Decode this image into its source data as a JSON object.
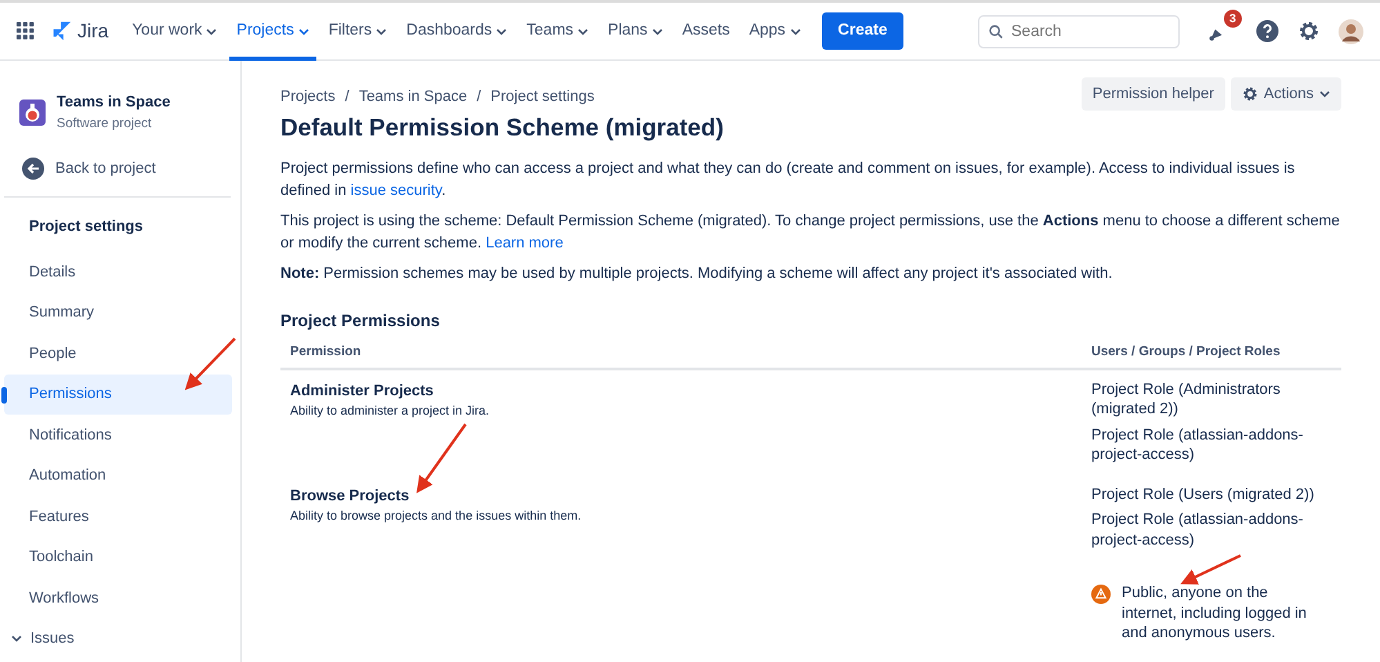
{
  "topbar": {
    "product": "Jira",
    "nav": [
      {
        "label": "Your work",
        "selected": false,
        "dropdown": true
      },
      {
        "label": "Projects",
        "selected": true,
        "dropdown": true
      },
      {
        "label": "Filters",
        "selected": false,
        "dropdown": true
      },
      {
        "label": "Dashboards",
        "selected": false,
        "dropdown": true
      },
      {
        "label": "Teams",
        "selected": false,
        "dropdown": true
      },
      {
        "label": "Plans",
        "selected": false,
        "dropdown": true
      },
      {
        "label": "Assets",
        "selected": false,
        "dropdown": false
      },
      {
        "label": "Apps",
        "selected": false,
        "dropdown": true
      }
    ],
    "create": "Create",
    "search": {
      "placeholder": "Search"
    },
    "notifications": "3"
  },
  "sidebar": {
    "project": {
      "name": "Teams in Space",
      "type": "Software project"
    },
    "back": "Back to project",
    "heading": "Project settings",
    "items": [
      {
        "label": "Details",
        "selected": false,
        "kind": "link"
      },
      {
        "label": "Summary",
        "selected": false,
        "kind": "link"
      },
      {
        "label": "People",
        "selected": false,
        "kind": "link"
      },
      {
        "label": "Permissions",
        "selected": true,
        "kind": "link"
      },
      {
        "label": "Notifications",
        "selected": false,
        "kind": "link"
      },
      {
        "label": "Automation",
        "selected": false,
        "kind": "link"
      },
      {
        "label": "Features",
        "selected": false,
        "kind": "link"
      },
      {
        "label": "Toolchain",
        "selected": false,
        "kind": "link"
      },
      {
        "label": "Workflows",
        "selected": false,
        "kind": "link"
      },
      {
        "label": "Issues",
        "selected": false,
        "kind": "group",
        "expanded": true
      }
    ]
  },
  "breadcrumbs": [
    {
      "label": "Projects"
    },
    {
      "separator": "/",
      "label": "Teams in Space"
    },
    {
      "separator": "/",
      "label": "Project settings"
    }
  ],
  "actions": {
    "helper": "Permission helper",
    "menu": "Actions"
  },
  "title": "Default Permission Scheme (migrated)",
  "paragraphs": [
    {
      "text": "Project permissions define who can access a project and what they can do (create and comment on issues, for example). Access to individual issues is defined in",
      "link": "issue security",
      "tail": "."
    },
    {
      "text": "This project is using the scheme: Default Permission Scheme (migrated). To change project permissions, use the **Actions** menu to choose a different scheme or modify the current scheme.",
      "link": "Learn more"
    },
    {
      "text": "**Note:** Permission schemes may be used by multiple projects. Modifying a scheme will affect any project it's associated with."
    }
  ],
  "section_title": "Project Permissions",
  "table": {
    "columns": [
      "Permission",
      "Users / Groups / Project Roles"
    ],
    "rows": [
      {
        "name": "Administer Projects",
        "description": "Ability to administer a project in Jira.",
        "grants": [
          {
            "kind": "role",
            "text": "Project Role (Administrators (migrated 2))"
          },
          {
            "kind": "role",
            "text": "Project Role (atlassian-addons-project-access)"
          }
        ]
      },
      {
        "name": "Browse Projects",
        "description": "Ability to browse projects and the issues within them.",
        "grants": [
          {
            "kind": "role",
            "text": "Project Role (Users (migrated 2))"
          },
          {
            "kind": "role",
            "text": "Project Role (atlassian-addons-project-access)"
          },
          {
            "kind": "warning",
            "text": "Public, anyone on the internet, including logged in and anonymous users."
          }
        ]
      }
    ]
  }
}
